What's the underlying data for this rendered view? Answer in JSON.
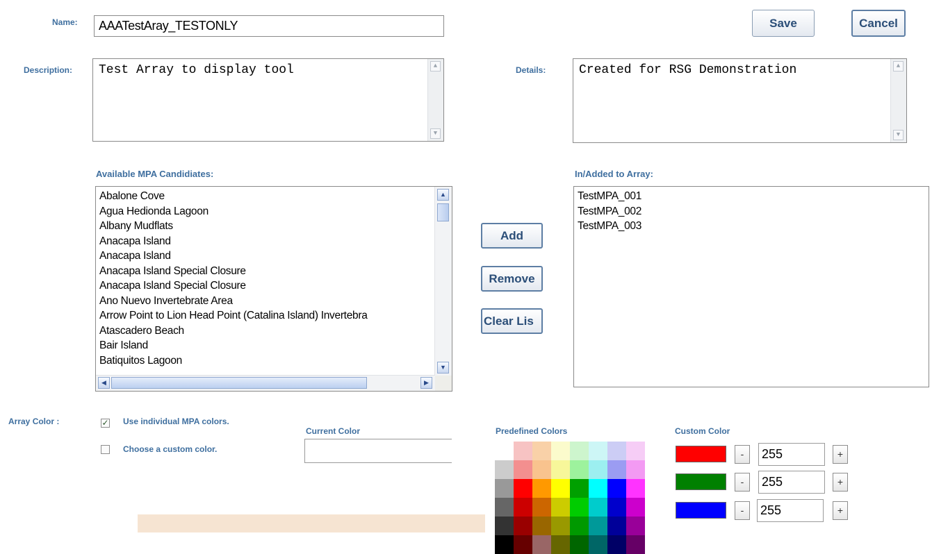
{
  "form": {
    "name_label": "Name:",
    "name_value": "AAATestAray_TESTONLY",
    "description_label": "Description:",
    "description_value": "Test Array to display tool",
    "details_label": "Details:",
    "details_value": "Created for RSG Demonstration"
  },
  "buttons": {
    "save": "Save",
    "cancel": "Cancel",
    "add": "Add",
    "remove": "Remove",
    "clear": "Clear Lis"
  },
  "available": {
    "label": "Available MPA Candidiates:",
    "items": [
      "Abalone Cove",
      "Agua Hedionda Lagoon",
      "Albany Mudflats",
      "Anacapa Island",
      "Anacapa Island",
      "Anacapa Island Special Closure",
      "Anacapa Island Special Closure",
      "Ano Nuevo Invertebrate Area",
      "Arrow Point to Lion Head Point (Catalina Island) Invertebra",
      "Atascadero Beach",
      "Bair Island",
      "Batiquitos Lagoon"
    ]
  },
  "added": {
    "label": "In/Added to Array:",
    "items": [
      "TestMPA_001",
      "TestMPA_002",
      "TestMPA_003"
    ]
  },
  "color": {
    "array_color_label": "Array Color :",
    "use_individual_label": "Use individual MPA colors.",
    "use_individual_checked": true,
    "custom_label": "Choose a custom color.",
    "custom_checked": false,
    "current_color_label": "Current Color",
    "predefined_label": "Predefined Colors",
    "custom_color_label": "Custom Color",
    "red_value": "255",
    "green_value": "255",
    "blue_value": "255",
    "minus": "-",
    "plus": "+",
    "red_color": "#ff0000",
    "green_color": "#008000",
    "blue_color": "#0000ff",
    "palette_rows": [
      [
        "#ffffff",
        "#f7c3c3",
        "#f9d1a8",
        "#fbfbcc",
        "#cdf5cd",
        "#cdf6f6",
        "#cccdf5",
        "#f6cdf6"
      ],
      [
        "#cccccc",
        "#f38f8f",
        "#f9c38e",
        "#f7f79a",
        "#9df29d",
        "#9ceff0",
        "#9b9cf2",
        "#f39af3"
      ],
      [
        "#999999",
        "#ff0000",
        "#ff9900",
        "#ffff00",
        "#00a000",
        "#00ffff",
        "#0000ff",
        "#ff33ff"
      ],
      [
        "#666666",
        "#cc0000",
        "#cc6600",
        "#cccc00",
        "#00cc00",
        "#00cccc",
        "#0000cc",
        "#cc00cc"
      ],
      [
        "#333333",
        "#990000",
        "#996600",
        "#999900",
        "#009900",
        "#009999",
        "#000099",
        "#990099"
      ],
      [
        "#000000",
        "#660000",
        "#996666",
        "#666600",
        "#006600",
        "#006666",
        "#000066",
        "#660066"
      ]
    ]
  }
}
